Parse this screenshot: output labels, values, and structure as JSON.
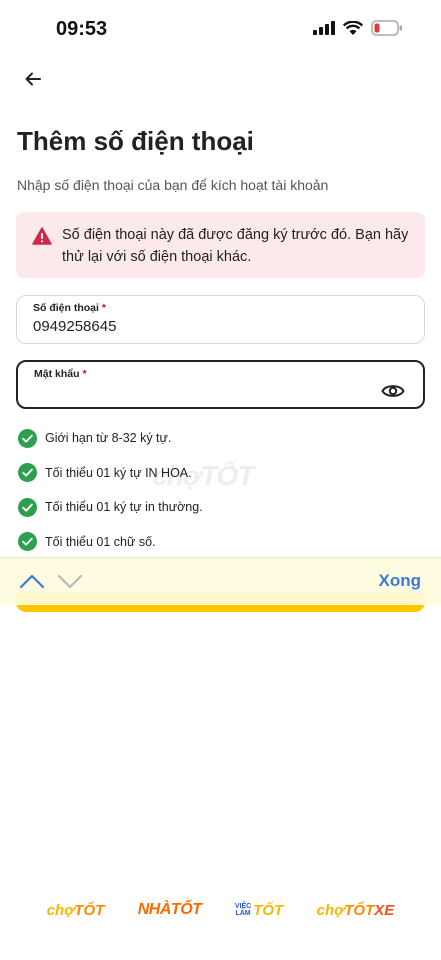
{
  "status_bar": {
    "time": "09:53",
    "icons": [
      "signal-icon",
      "wifi-icon",
      "battery-icon"
    ]
  },
  "header": {
    "back_icon": "arrow-left-icon",
    "title": "Thêm số điện thoại",
    "subtitle": "Nhập số điện thoại của bạn để kích hoạt tài khoản"
  },
  "error": {
    "icon": "warning-triangle-icon",
    "message_line1": "Số điện thoại này đã được đăng ký trước đó. Bạn hãy",
    "message_line2": "thử lại với số điện thoại khác.",
    "color": "#fce9ec"
  },
  "form": {
    "phone": {
      "label": "Số điện thoại",
      "required_mark": "*",
      "value": "0949258645"
    },
    "password": {
      "label": "Mật khẩu",
      "required_mark": "*",
      "value": "",
      "toggle_icon": "eye-icon"
    }
  },
  "password_rules": [
    {
      "text": "Giới hạn từ 8-32 ký tự.",
      "satisfied": true
    },
    {
      "text": "Tối thiểu 01 ký tự IN HOA.",
      "satisfied": true
    },
    {
      "text": "Tối thiểu 01 ký tự in thường.",
      "satisfied": true
    },
    {
      "text": "Tối thiểu 01 chữ số.",
      "satisfied": true
    }
  ],
  "watermark": "chợTỐT",
  "keyboard_toolbar": {
    "up_icon": "chevron-up-icon",
    "down_icon": "chevron-down-icon",
    "done_label": "Xong"
  },
  "footer_brands": {
    "cho_tot_1": "chợ",
    "cho_tot_2": "TỐT",
    "nha_tot": "NHÀTỐT",
    "viec_lam_1": "VIỆC",
    "viec_lam_2": "LÀM",
    "viec_lam_3": "TỐT",
    "xe_1": "chợ",
    "xe_2": "TỐT",
    "xe_3": "XE"
  },
  "colors": {
    "accent_yellow": "#ffc700",
    "success_green": "#2e9e4f",
    "error_red": "#e0003c",
    "link_blue": "#3a7bd5"
  }
}
